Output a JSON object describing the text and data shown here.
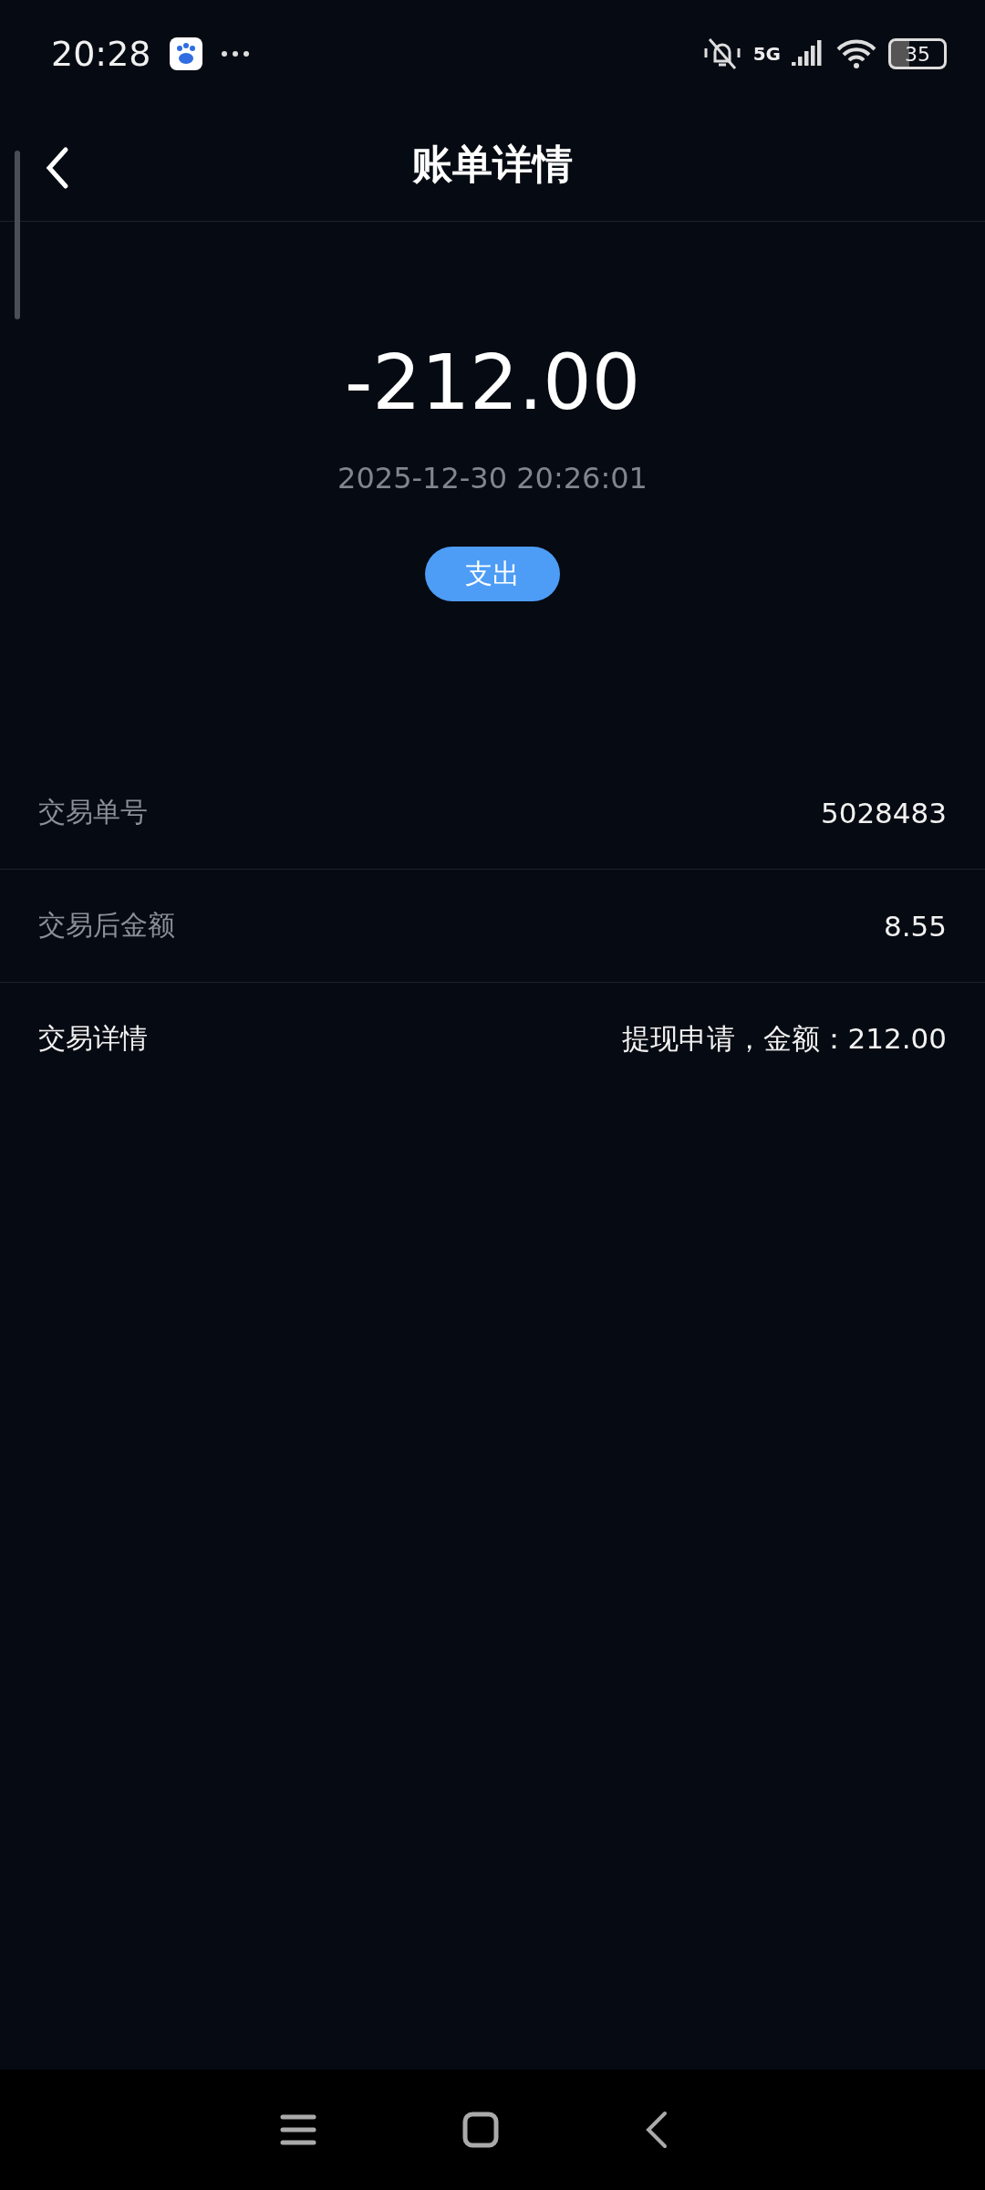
{
  "status_bar": {
    "time": "20:28",
    "network": "5G",
    "battery": "35"
  },
  "header": {
    "title": "账单详情"
  },
  "summary": {
    "amount": "-212.00",
    "datetime": "2025-12-30 20:26:01",
    "badge": "支出"
  },
  "rows": [
    {
      "label": "交易单号",
      "value": "5028483",
      "kind": "muted"
    },
    {
      "label": "交易后金额",
      "value": "8.55",
      "kind": "muted"
    },
    {
      "label": "交易详情",
      "value": "提现申请，金额：212.00",
      "kind": "bright"
    }
  ]
}
